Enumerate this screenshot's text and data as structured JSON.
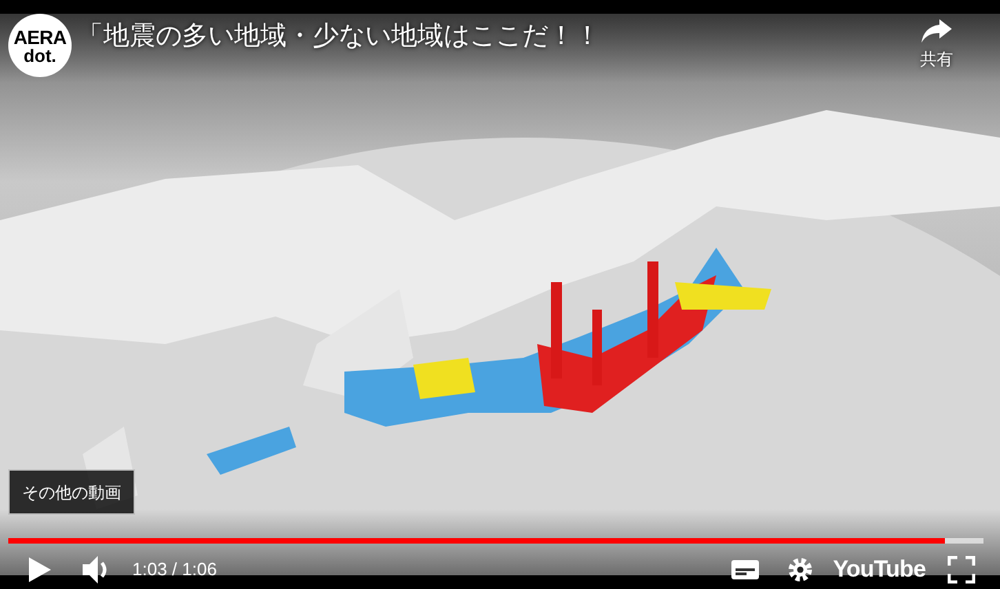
{
  "player": {
    "channel_logo": {
      "line_1": "AERA",
      "line_2": "dot."
    },
    "title": "「地震の多い地域・少ない地域はここだ！！",
    "share": {
      "label": "共有"
    },
    "more_videos": {
      "label": "その他の動画"
    },
    "progress": {
      "level": 0.96
    },
    "time": "1:03 / 1:06",
    "brand": "YouTube"
  }
}
